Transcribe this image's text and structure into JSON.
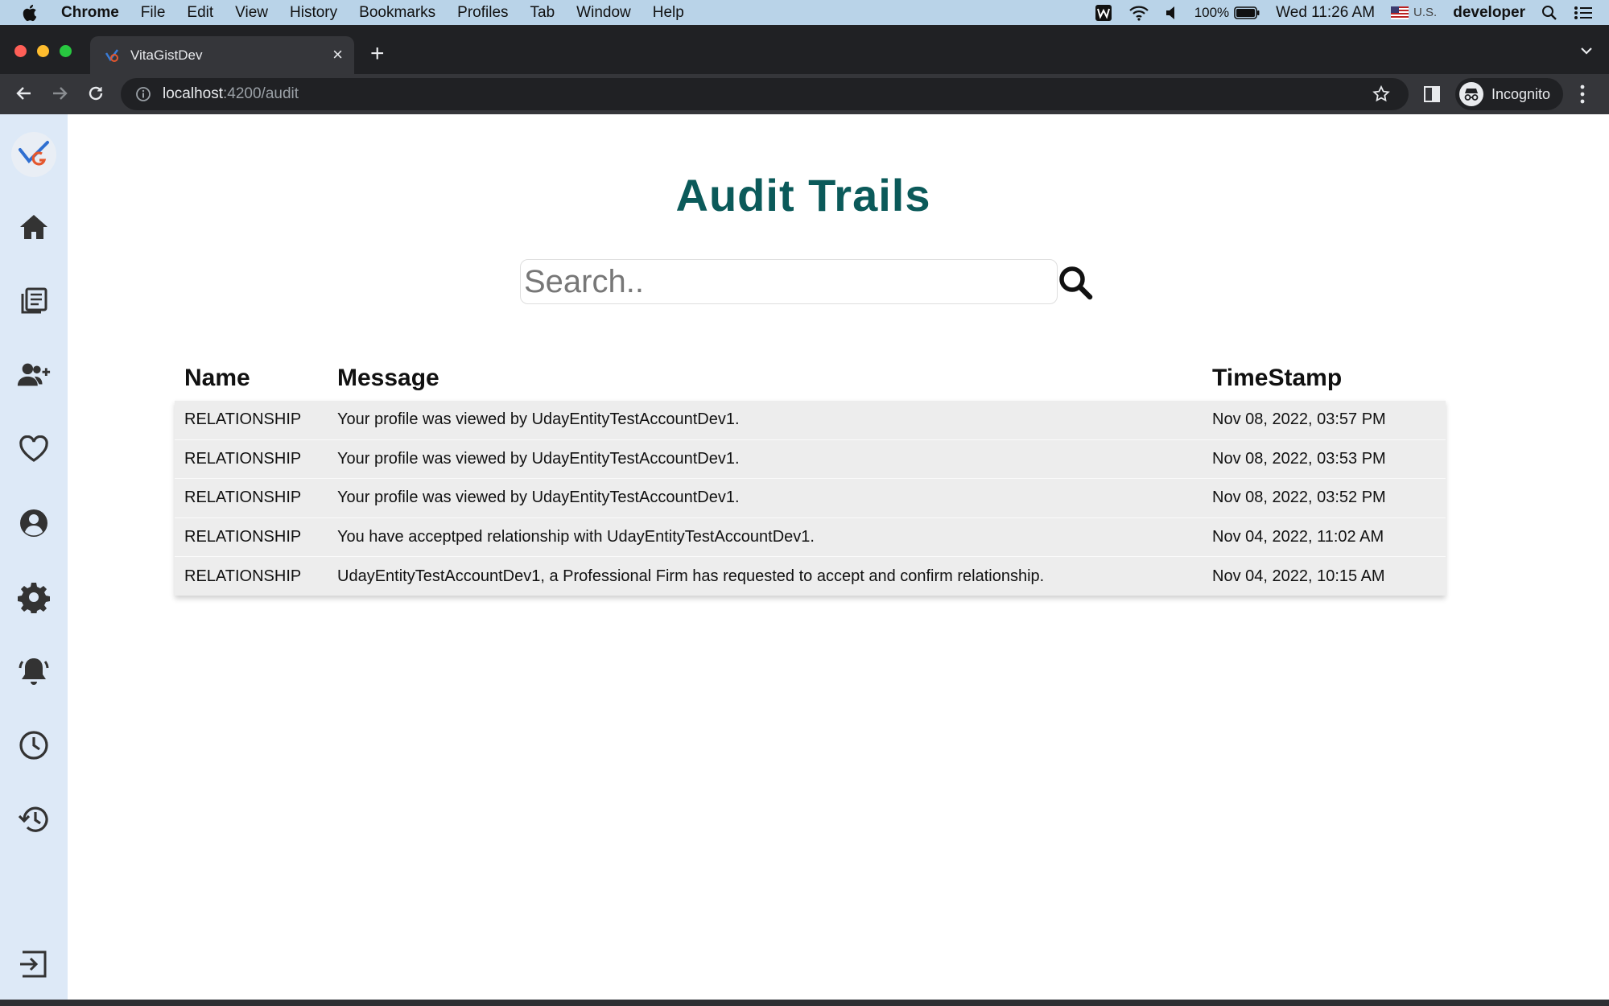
{
  "menubar": {
    "app_name": "Chrome",
    "items": [
      "File",
      "Edit",
      "View",
      "History",
      "Bookmarks",
      "Profiles",
      "Tab",
      "Window",
      "Help"
    ],
    "battery": "100%",
    "clock": "Wed 11:26 AM",
    "input_source": "U.S.",
    "user": "developer"
  },
  "browser": {
    "tab_title": "VitaGistDev",
    "url_host": "localhost",
    "url_path": ":4200/audit",
    "profile_label": "Incognito"
  },
  "page": {
    "title": "Audit Trails",
    "search": {
      "placeholder": "Search..",
      "value": ""
    }
  },
  "table": {
    "headers": {
      "name": "Name",
      "message": "Message",
      "timestamp": "TimeStamp"
    },
    "rows": [
      {
        "name": "RELATIONSHIP",
        "message": "Your profile was viewed by UdayEntityTestAccountDev1.",
        "timestamp": "Nov 08, 2022, 03:57 PM"
      },
      {
        "name": "RELATIONSHIP",
        "message": "Your profile was viewed by UdayEntityTestAccountDev1.",
        "timestamp": "Nov 08, 2022, 03:53 PM"
      },
      {
        "name": "RELATIONSHIP",
        "message": "Your profile was viewed by UdayEntityTestAccountDev1.",
        "timestamp": "Nov 08, 2022, 03:52 PM"
      },
      {
        "name": "RELATIONSHIP",
        "message": "You have acceptped relationship with UdayEntityTestAccountDev1.",
        "timestamp": "Nov 04, 2022, 11:02 AM"
      },
      {
        "name": "RELATIONSHIP",
        "message": "UdayEntityTestAccountDev1, a Professional Firm has requested to accept and confirm relationship.",
        "timestamp": "Nov 04, 2022, 10:15 AM"
      }
    ]
  },
  "sidebar": {
    "icons": [
      "home-icon",
      "documents-icon",
      "add-user-icon",
      "heart-icon",
      "profile-icon",
      "settings-icon",
      "notification-bell-icon",
      "clock-icon",
      "history-icon",
      "logout-icon"
    ]
  },
  "colors": {
    "title": "#0b5a5a",
    "sidebar_bg": "#dde9f7",
    "menubar_bg": "#b9d3e8",
    "table_row_bg": "#ededed"
  }
}
